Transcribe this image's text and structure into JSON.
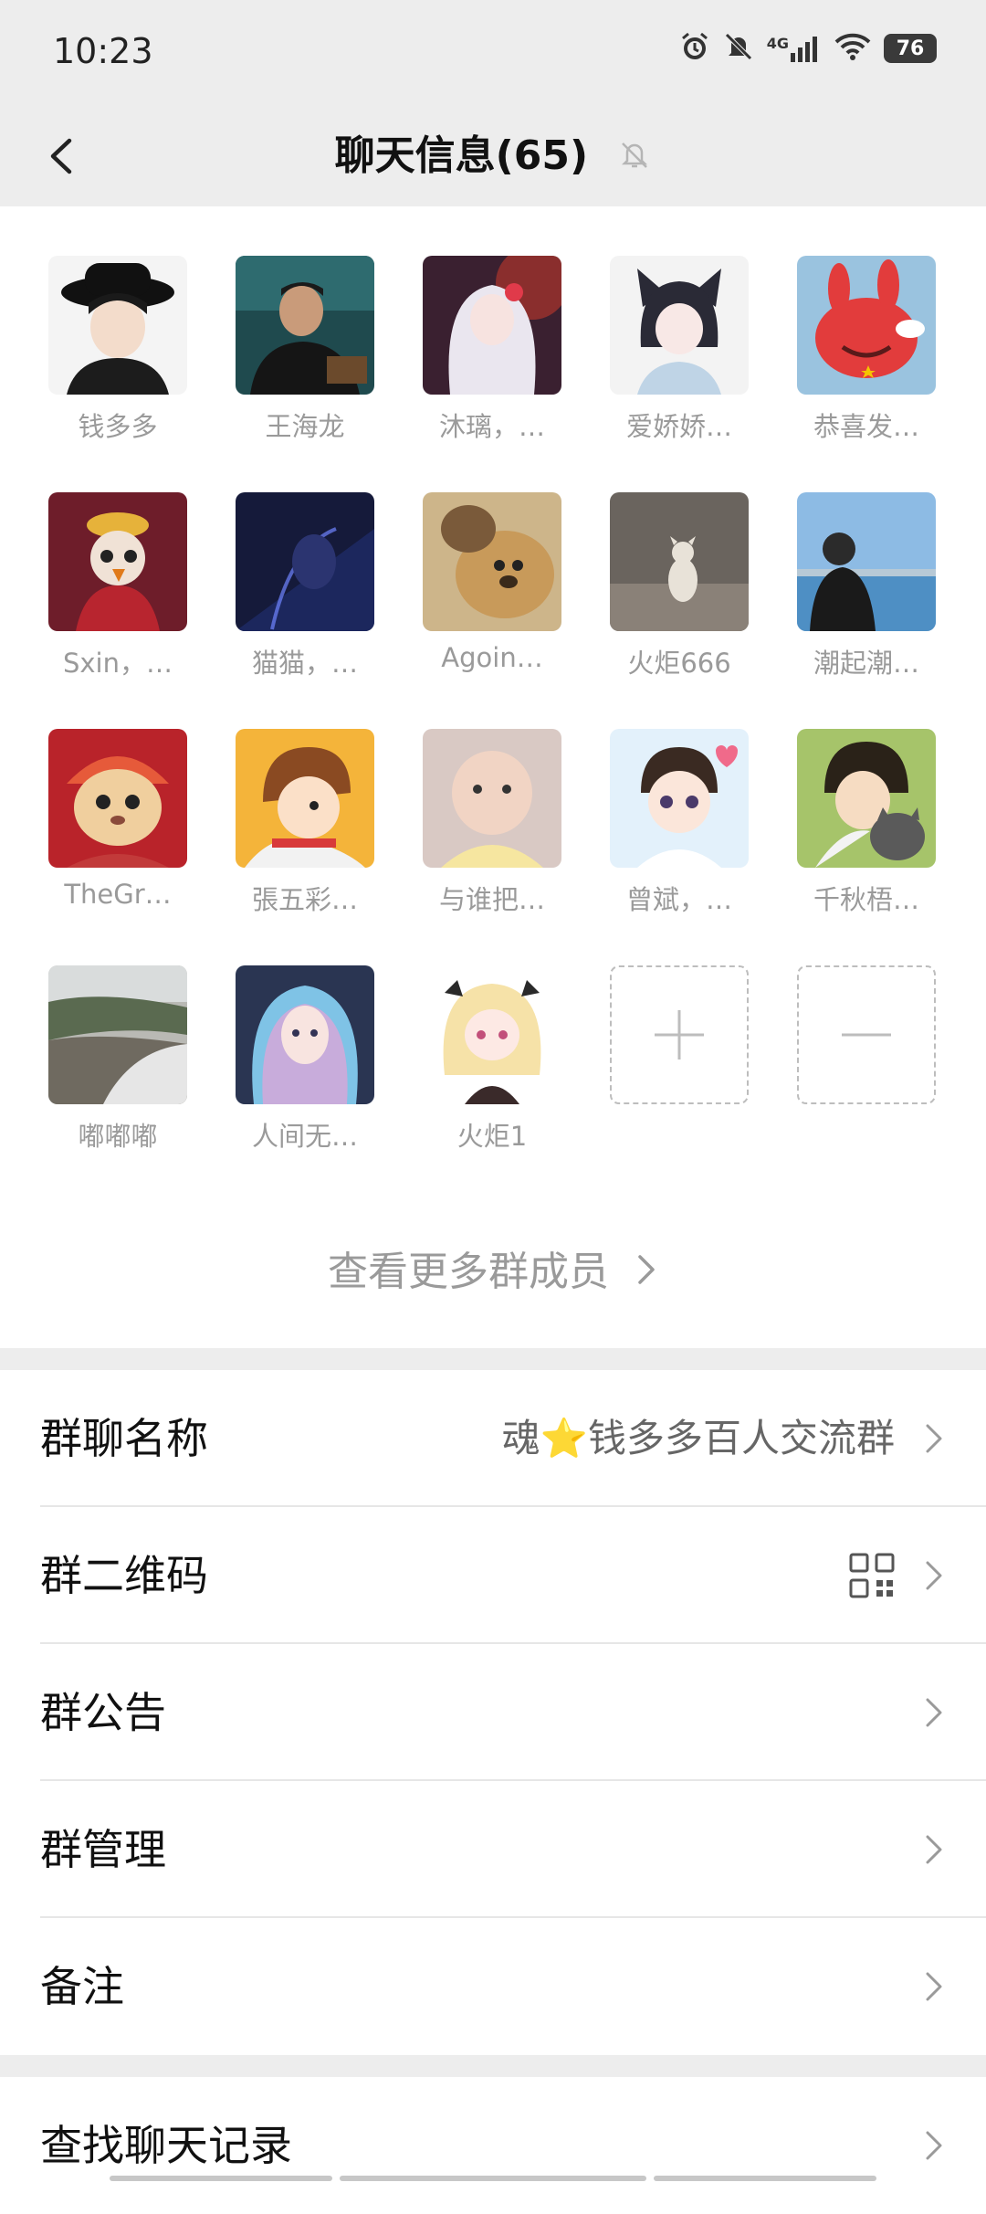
{
  "status_bar": {
    "time": "10:23",
    "network": "4G",
    "battery": "76"
  },
  "header": {
    "title": "聊天信息(65)"
  },
  "members": [
    {
      "name": "钱多多",
      "icon": "avatar-anime-boy-hat"
    },
    {
      "name": "王海龙",
      "icon": "avatar-man-suit"
    },
    {
      "name": "沐璃，…",
      "icon": "avatar-anime-white-hair"
    },
    {
      "name": "爱娇娇…",
      "icon": "avatar-anime-cat-ears"
    },
    {
      "name": "恭喜发…",
      "icon": "avatar-red-bunny"
    },
    {
      "name": "Sxin，…",
      "icon": "avatar-rooster"
    },
    {
      "name": "猫猫，…",
      "icon": "avatar-dark-anime"
    },
    {
      "name": "Agoin…",
      "icon": "avatar-dog-bear"
    },
    {
      "name": "火炬666",
      "icon": "avatar-cat-photo"
    },
    {
      "name": "潮起潮…",
      "icon": "avatar-man-lake"
    },
    {
      "name": "TheGr…",
      "icon": "avatar-cat-headdress"
    },
    {
      "name": "張五彩…",
      "icon": "avatar-cartoon-boy"
    },
    {
      "name": "与谁把…",
      "icon": "avatar-baby"
    },
    {
      "name": "曾斌，…",
      "icon": "avatar-chibi-boy"
    },
    {
      "name": "千秋梧…",
      "icon": "avatar-boy-cat"
    },
    {
      "name": "嘟嘟嘟",
      "icon": "avatar-river-landscape"
    },
    {
      "name": "人间无…",
      "icon": "avatar-rainbow-girl"
    },
    {
      "name": "火炬1",
      "icon": "avatar-chibi-blonde"
    }
  ],
  "see_more_label": "查看更多群成员",
  "settings": {
    "group_name_label": "群聊名称",
    "group_name_value": "魂⭐钱多多百人交流群",
    "qr_label": "群二维码",
    "announcement_label": "群公告",
    "manage_label": "群管理",
    "remark_label": "备注",
    "search_history_label": "查找聊天记录"
  },
  "colors": {
    "header_bg": "#ededed",
    "muted_text": "#9a9a9a",
    "divider": "#e6e6e6"
  }
}
